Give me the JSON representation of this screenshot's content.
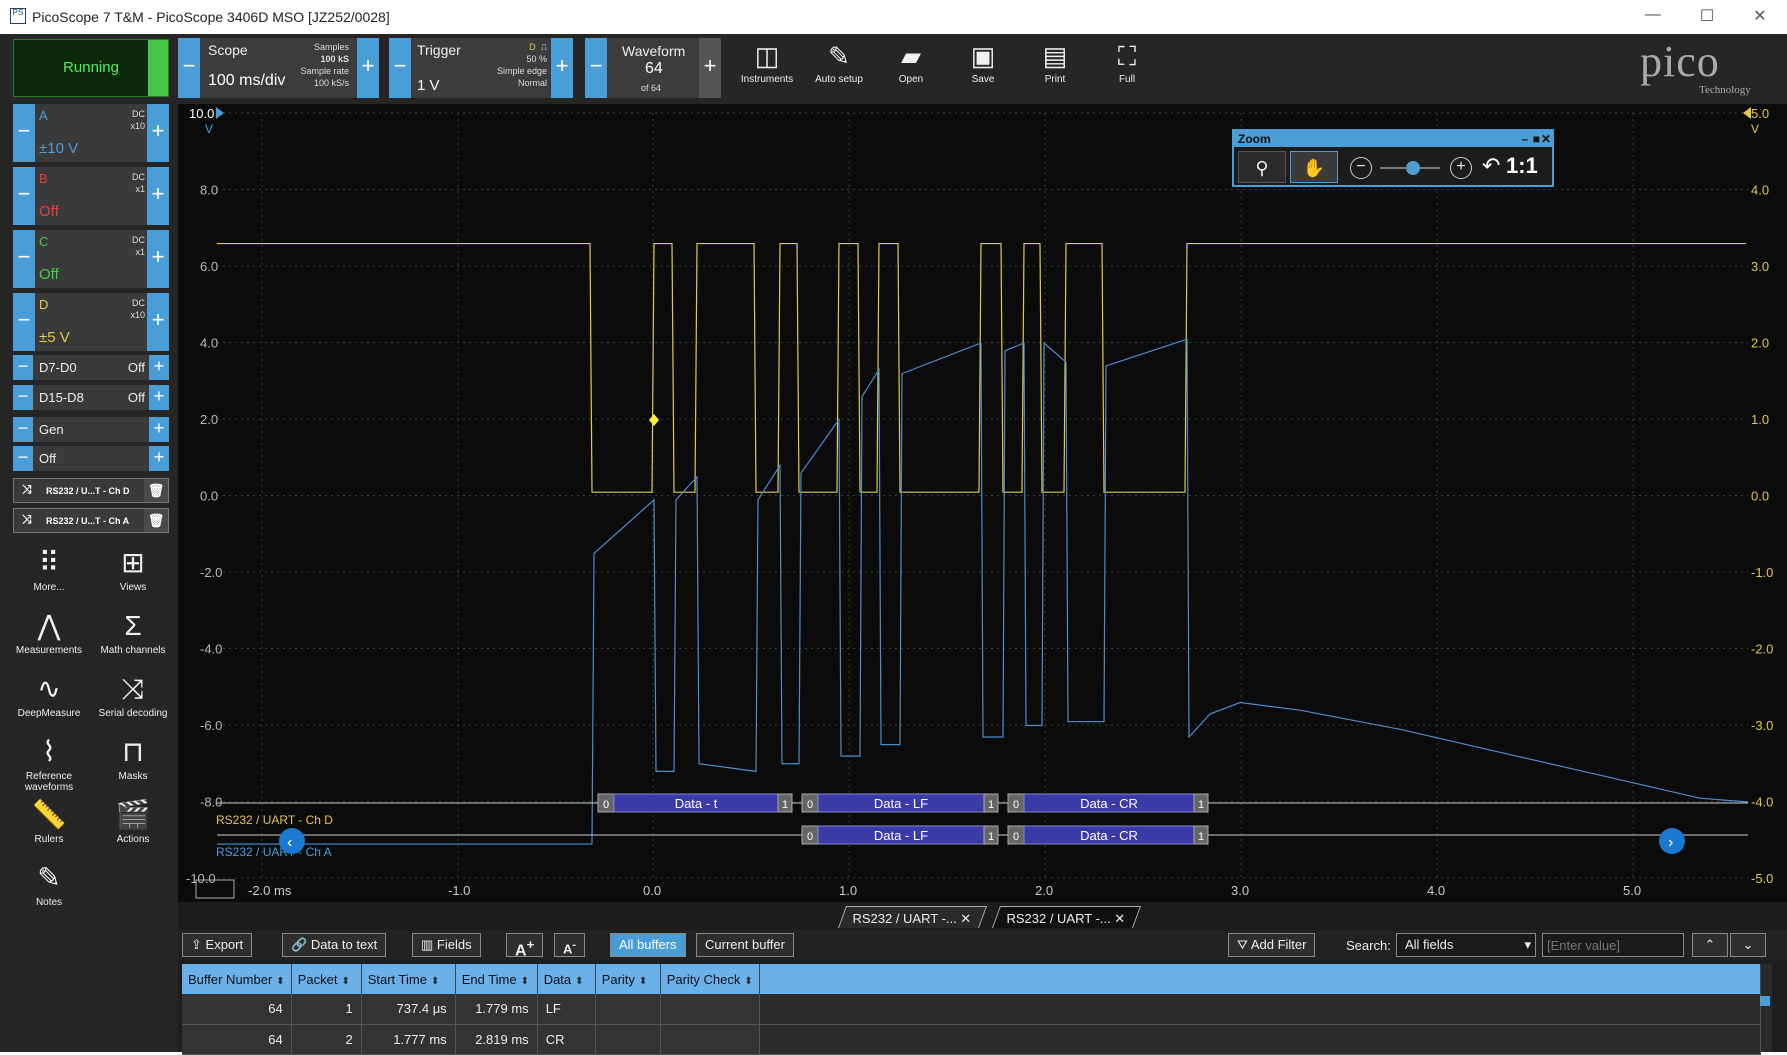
{
  "window": {
    "title": "PicoScope 7 T&M - PicoScope 3406D MSO [JZ252/0028]"
  },
  "toolbar": {
    "run_label": "Running",
    "scope": {
      "label": "Scope",
      "timebase": "100 ms/div",
      "samples_label": "Samples",
      "samples": "100 kS",
      "rate_label": "Sample rate",
      "rate": "100 kS/s"
    },
    "trigger": {
      "label": "Trigger",
      "level": "1 V",
      "channel": "D",
      "pct": "50 %",
      "type": "Simple edge",
      "mode": "Normal"
    },
    "waveform": {
      "label": "Waveform",
      "number": "64",
      "of": "of 64"
    },
    "tools": [
      {
        "label": "Instruments",
        "icon": "instruments-icon"
      },
      {
        "label": "Auto setup",
        "icon": "auto-setup-icon"
      },
      {
        "label": "Open",
        "icon": "folder-open-icon"
      },
      {
        "label": "Save",
        "icon": "save-icon"
      },
      {
        "label": "Print",
        "icon": "printer-icon"
      },
      {
        "label": "Full",
        "icon": "fullscreen-icon"
      }
    ],
    "logo": "pico",
    "logo_sub": "Technology"
  },
  "channels": [
    {
      "name": "A",
      "coupling": "DC",
      "probe": "x10",
      "range": "±10 V",
      "color": "#4a9ed8"
    },
    {
      "name": "B",
      "coupling": "DC",
      "probe": "x1",
      "range": "Off",
      "color": "#e84040"
    },
    {
      "name": "C",
      "coupling": "DC",
      "probe": "x1",
      "range": "Off",
      "color": "#3fcf3f"
    },
    {
      "name": "D",
      "coupling": "DC",
      "probe": "x10",
      "range": "±5 V",
      "color": "#e3c84a"
    }
  ],
  "digital": [
    {
      "name": "D7-D0",
      "state": "Off"
    },
    {
      "name": "D15-D8",
      "state": "Off"
    }
  ],
  "generator": {
    "name": "Gen",
    "state": "Off"
  },
  "decoders": [
    {
      "label": "RS232 / U...T - Ch D"
    },
    {
      "label": "RS232 / U...T - Ch A"
    }
  ],
  "side_tools": [
    {
      "label": "More...",
      "icon": "more-icon"
    },
    {
      "label": "Views",
      "icon": "views-icon"
    },
    {
      "label": "Measurements",
      "icon": "measurements-icon"
    },
    {
      "label": "Math channels",
      "icon": "sigma-icon"
    },
    {
      "label": "DeepMeasure",
      "icon": "deepmeasure-icon"
    },
    {
      "label": "Serial decoding",
      "icon": "serial-decoding-icon"
    },
    {
      "label": "Reference waveforms",
      "icon": "reference-waveforms-icon"
    },
    {
      "label": "Masks",
      "icon": "masks-icon"
    },
    {
      "label": "Rulers",
      "icon": "rulers-icon"
    },
    {
      "label": "Actions",
      "icon": "actions-icon"
    },
    {
      "label": "Notes",
      "icon": "notes-icon"
    }
  ],
  "scope": {
    "left_axis": {
      "unit": "V",
      "ticks": [
        "10.0",
        "8.0",
        "6.0",
        "4.0",
        "2.0",
        "0.0",
        "-2.0",
        "-4.0",
        "-6.0",
        "-8.0",
        "-10.0"
      ]
    },
    "right_axis": {
      "unit": "V",
      "ticks": [
        "5.0",
        "4.0",
        "3.0",
        "2.0",
        "1.0",
        "0.0",
        "-1.0",
        "-2.0",
        "-3.0",
        "-4.0",
        "-5.0"
      ]
    },
    "x_axis": {
      "ticks": [
        "-2.0 ms",
        "-1.0",
        "0.0",
        "1.0",
        "2.0",
        "3.0",
        "4.0",
        "5.0"
      ]
    },
    "zoom": {
      "title": "Zoom",
      "ratio": "1:1"
    },
    "decode_rows": [
      {
        "label": "RS232 / UART - Ch D",
        "packets": [
          {
            "text": "Data - t"
          },
          {
            "text": "Data - LF"
          },
          {
            "text": "Data - CR"
          }
        ]
      },
      {
        "label": "RS232 / UART - Ch A",
        "packets": [
          {
            "text": "Data - LF"
          },
          {
            "text": "Data - CR"
          }
        ]
      }
    ],
    "bits": {
      "start": "0",
      "stop": "1"
    }
  },
  "tabs": [
    {
      "label": "RS232 / UART -..."
    },
    {
      "label": "RS232 / UART -..."
    }
  ],
  "table_toolbar": {
    "export": "Export",
    "data_to_text": "Data to text",
    "fields": "Fields",
    "font_up": "A",
    "font_down": "A",
    "all_buffers": "All buffers",
    "current_buffer": "Current buffer",
    "add_filter": "Add Filter",
    "search_label": "Search:",
    "search_field": "All fields",
    "search_placeholder": "[Enter value]"
  },
  "table": {
    "columns": [
      "Buffer Number",
      "Packet",
      "Start Time",
      "End Time",
      "Data",
      "Parity",
      "Parity Check"
    ],
    "rows": [
      [
        "64",
        "1",
        "737.4 μs",
        "1.779 ms",
        "LF",
        "",
        ""
      ],
      [
        "64",
        "2",
        "1.777 ms",
        "2.819 ms",
        "CR",
        "",
        ""
      ]
    ]
  }
}
